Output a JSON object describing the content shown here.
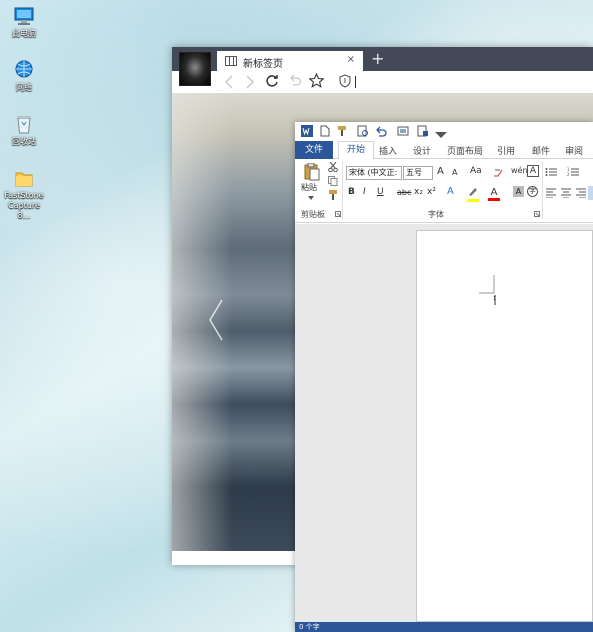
{
  "desktop": {
    "icons": [
      {
        "label": "此电脑",
        "icon": "computer-icon"
      },
      {
        "label": "网络",
        "icon": "network-icon"
      },
      {
        "label": "回收站",
        "icon": "recycle-bin-icon"
      },
      {
        "label": "FastStone Capture 8...",
        "icon": "folder-icon"
      }
    ]
  },
  "browser": {
    "tab_title": "新标签页",
    "tab_close": "×",
    "new_tab": "+",
    "toolbar_icons": [
      "back-icon",
      "forward-icon",
      "refresh-icon",
      "undo-icon",
      "star-icon",
      "shield-icon"
    ]
  },
  "word": {
    "tabs": [
      "文件",
      "开始",
      "插入",
      "设计",
      "页面布局",
      "引用",
      "邮件",
      "审阅"
    ],
    "active_tab": "开始",
    "ribbon": {
      "paste_label": "粘贴",
      "clipboard_group": "剪贴板",
      "font_group": "字体",
      "font_name": "宋体 (中文正:",
      "font_size": "五号",
      "grow_font": "A",
      "shrink_font": "A",
      "change_case": "Aa",
      "bold": "B",
      "italic": "I",
      "underline": "U",
      "strikethrough": "abc",
      "subscript": "x₂",
      "superscript": "x²",
      "text_effects": "A",
      "font_color": "A",
      "char_shading": "A",
      "enclose": "字"
    },
    "status": {
      "word_count": "0 个字"
    },
    "colors": {
      "accent": "#2b579a",
      "highlight": "#ffff00",
      "font_color": "#ff0000"
    }
  }
}
